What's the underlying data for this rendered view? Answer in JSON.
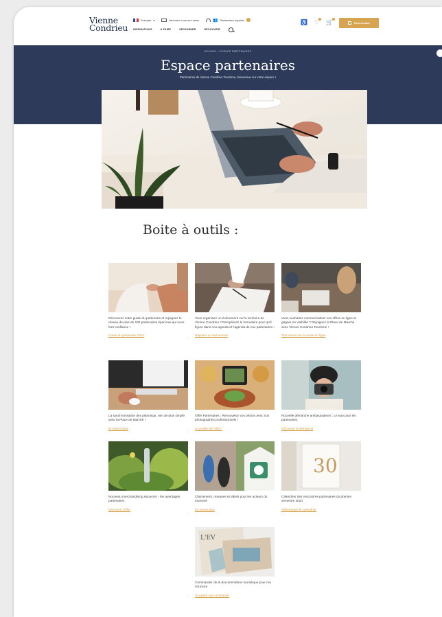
{
  "header": {
    "logo_line1": "Vienne",
    "logo_line2": "Condrieu",
    "language": "Français",
    "newsletter": "Abonnez-vous aux news",
    "partner_link": "Partenaires supplier",
    "nav": [
      "INSPIRATIONS",
      "À FAIRE",
      "SÉJOURNER",
      "DÉCOUVRIR"
    ],
    "reserve_label": "Réservation"
  },
  "hero": {
    "breadcrumb": "ACCUEIL  >  ESPACE PARTENAIRES",
    "title": "Espace partenaires",
    "subtitle": "Partenaires de Vienne Condrieu Tourisme, bienvenue sur votre espace !"
  },
  "toolbox": {
    "title": "Boite à outils :",
    "cards": [
      {
        "desc": "Découvrez notre guide du partenaire et rejoignez le réseau de plus de 100 partenaires épanouis qui nous font confiance !",
        "link": "Guide du partenaire 2024"
      },
      {
        "desc": "Vous organisez un événement sur le territoire de Vienne Condrieu ? Remplissez le formulaire pour qu'il figure dans nos agenda et l'agenda de nos partenaires !",
        "link": "Déposer un événement"
      },
      {
        "desc": "Vous souhaitez commercialiser vos offres en ligne et gagner en visibilité ? Rejoignez la Place de Marché avec Vienne Condrieu Tourisme !",
        "link": "Tout savoir sur la vente en ligne"
      },
      {
        "desc": "La synchronisation des plannings, rien de plus simple avec la Place de Marché !",
        "link": "En savoir plus"
      },
      {
        "desc": "Offre Partenaires : Renouvelez vos photos avec nos photographes professionnels !",
        "link": "Je profite de l'offre !"
      },
      {
        "desc": "Nouvelle démarche ambassadeurs : Le tuto pour les partenaires",
        "link": "Découvrir la démarche"
      },
      {
        "desc": "Nouveau merchandising épouvrez - les avantages partenaires",
        "link": "Découvrir l'offre"
      },
      {
        "desc": "Classement, marques et labels pour les acteurs du tourisme",
        "link": "En savoir plus"
      },
      {
        "desc": "Calendrier des rencontres partenaires du premier semestre 2024",
        "link": "Télécharger le calendrier"
      },
      {
        "desc": "Commander de la documentation touristique pour ma structure",
        "link": "Je passe ma commande"
      }
    ]
  },
  "colors": {
    "navy": "#2d3a5a",
    "gold": "#d7a451"
  }
}
